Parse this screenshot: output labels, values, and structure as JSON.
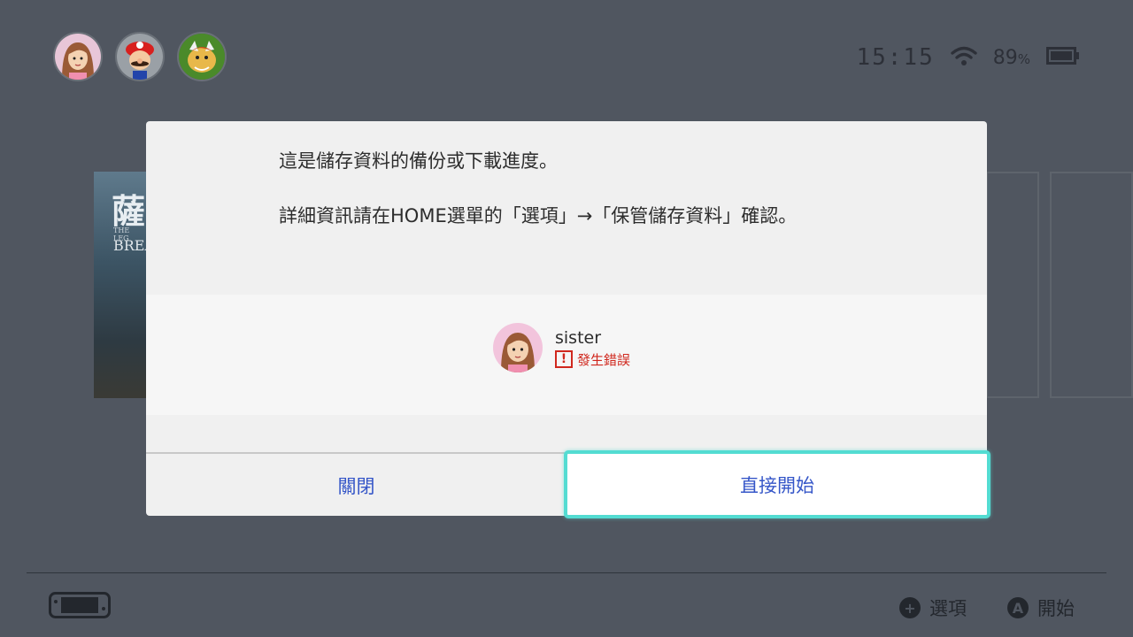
{
  "status_bar": {
    "time": "15:15",
    "battery_percent": "89",
    "battery_unit": "%",
    "wifi_icon": "wifi-icon",
    "battery_icon": "battery-icon"
  },
  "user_avatars": [
    "sister-avatar",
    "mario-avatar",
    "bowser-avatar"
  ],
  "background_game": {
    "cover_glyph": "薩",
    "cover_line1": "THE LEG",
    "cover_line2": "BREA"
  },
  "dialog": {
    "message_line1": "這是儲存資料的備份或下載進度。",
    "message_line2": "詳細資訊請在HOME選單的「選項」→「保管儲存資料」確認。",
    "user": {
      "name": "sister",
      "status_icon": "!",
      "status_text": "發生錯誤"
    },
    "buttons": {
      "close_label": "關閉",
      "start_label": "直接開始"
    },
    "focus_color": "#53dcd2",
    "error_color": "#d0281e",
    "button_text_color": "#3556c8"
  },
  "footer": {
    "options_icon": "+",
    "options_label": "選項",
    "start_icon": "A",
    "start_label": "開始"
  }
}
